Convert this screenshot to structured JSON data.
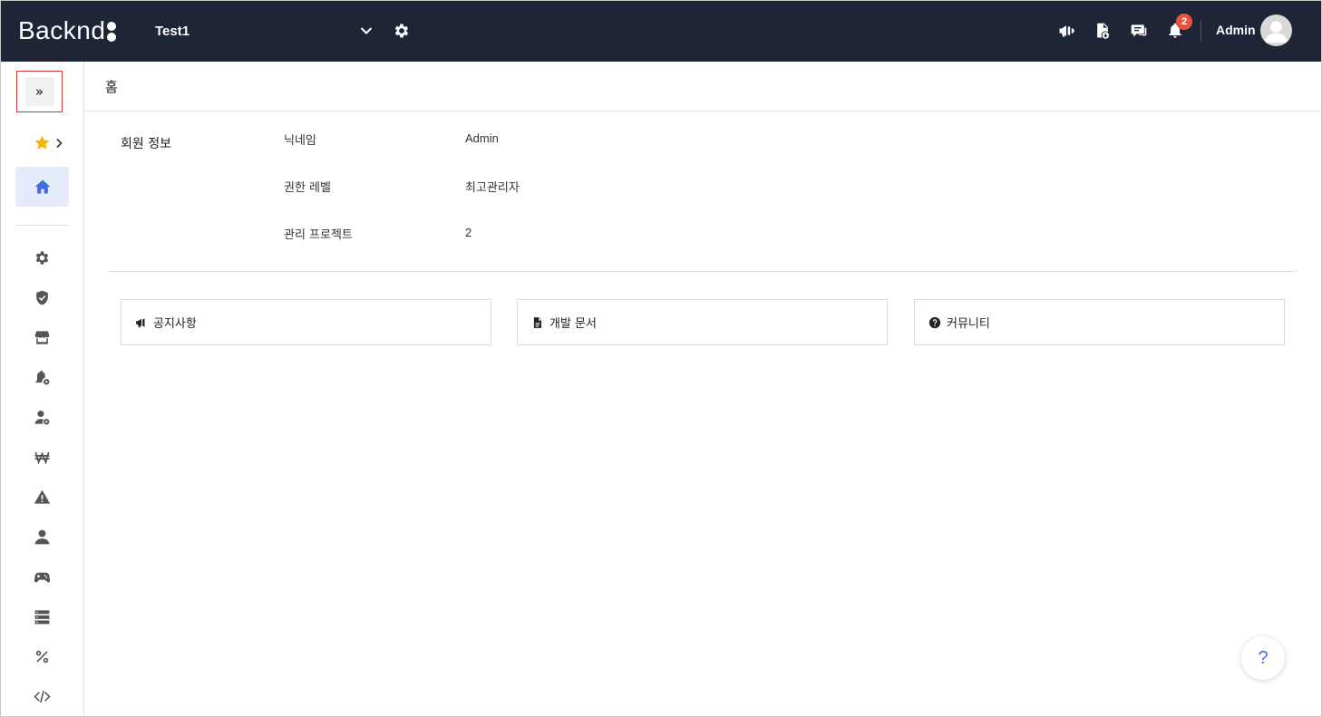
{
  "header": {
    "logo": "Backnd",
    "project_name": "Test1",
    "notification_count": "2",
    "user_name": "Admin"
  },
  "sidebar": {
    "expand_label": "»"
  },
  "page": {
    "title": "홈"
  },
  "member_info": {
    "title": "회원 정보",
    "rows": [
      {
        "label": "닉네임",
        "value": "Admin"
      },
      {
        "label": "권한 레벨",
        "value": "최고관리자"
      },
      {
        "label": "관리 프로젝트",
        "value": "2"
      }
    ]
  },
  "cards": [
    {
      "label": "공지사항",
      "icon": "bullhorn-icon"
    },
    {
      "label": "개발 문서",
      "icon": "file-icon"
    },
    {
      "label": "커뮤니티",
      "icon": "question-circle-icon"
    }
  ],
  "help": {
    "label": "?"
  },
  "colors": {
    "topbar": "#1d2537",
    "accent": "#3c6ee0",
    "badge": "#e8543a",
    "home_active_bg": "#e5ebfb",
    "star": "#f5b400"
  }
}
